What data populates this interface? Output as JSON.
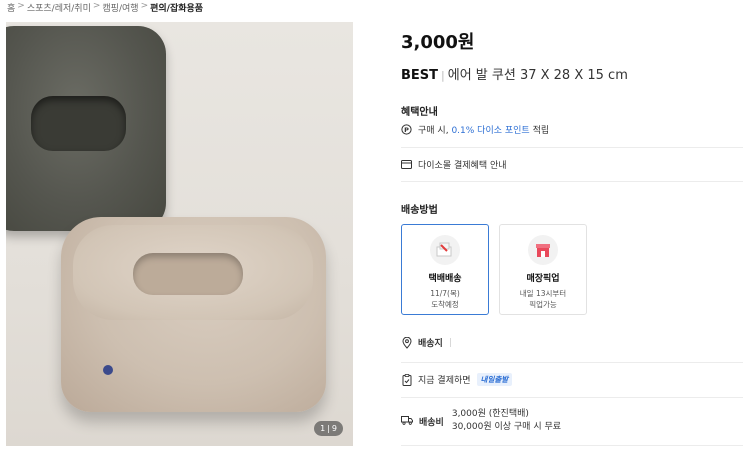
{
  "breadcrumb": {
    "items": [
      "홈",
      "스포츠/레저/취미",
      "캠핑/여행",
      "편의/잡화용품"
    ],
    "separator": ">"
  },
  "gallery": {
    "counter_current": "1",
    "counter_total": "9"
  },
  "product": {
    "price": "3,000원",
    "badge": "BEST",
    "name": "에어 발 쿠션 37 X 28 X 15 cm"
  },
  "benefits": {
    "heading": "혜택안내",
    "point_prefix": "구매 시,",
    "point_link": "0.1% 다이소 포인트",
    "point_suffix": "적립",
    "payment_info": "다이소몰 결제혜택 안내"
  },
  "shipping": {
    "heading": "배송방법",
    "options": [
      {
        "name": "택배배송",
        "line1": "11/7(목)",
        "line2": "도착예정",
        "selected": true
      },
      {
        "name": "매장픽업",
        "line1": "내일 13시부터",
        "line2": "픽업가능",
        "selected": false
      }
    ],
    "destination_label": "배송지",
    "pay_now_text": "지금 결제하면",
    "pay_now_tag": "내일출발",
    "fee_label": "배송비",
    "fee_line1": "3,000원 (한진택배)",
    "fee_line2": "30,000원 이상 구매 시 무료"
  },
  "icons": [
    "point-icon",
    "card-icon",
    "truck-box-icon",
    "store-pickup-icon",
    "location-pin-icon",
    "clipboard-icon",
    "truck-icon"
  ],
  "colors": {
    "accent": "#3a7bd5",
    "link": "#2d6fd4"
  }
}
